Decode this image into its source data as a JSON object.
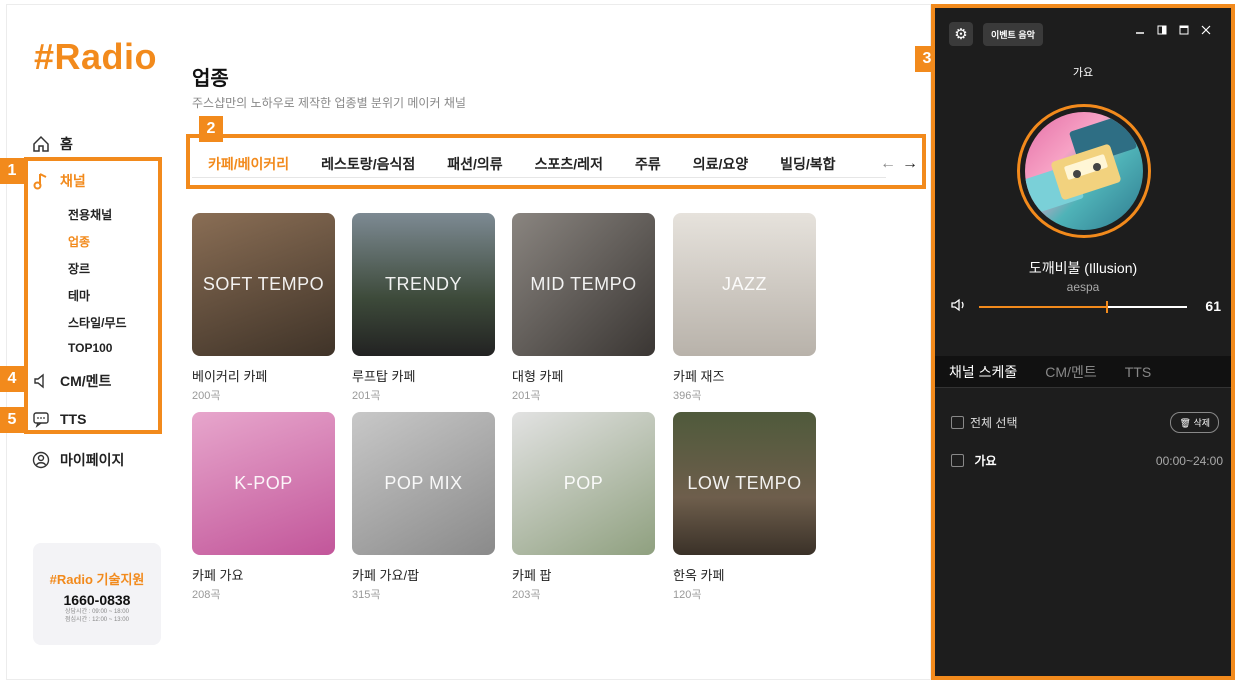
{
  "logo": "#Radio",
  "nav": {
    "home": "홈",
    "channel": "채널",
    "channel_sub": [
      "전용채널",
      "업종",
      "장르",
      "테마",
      "스타일/무드",
      "TOP100"
    ],
    "active_sub": "업종",
    "cm": "CM/멘트",
    "tts": "TTS",
    "mypage": "마이페이지"
  },
  "support": {
    "title": "#Radio 기술지원",
    "phone": "1660-0838",
    "hours1": "상담시간 : 09:00 ~ 18:00",
    "hours2": "점심시간 : 12:00 ~ 13:00"
  },
  "header": {
    "title": "업종",
    "subtitle": "주스샵만의 노하우로 제작한 업종별 분위기 메이커 채널"
  },
  "tabs": [
    "카페/베이커리",
    "레스토랑/음식점",
    "패션/의류",
    "스포츠/레저",
    "주류",
    "의료/요양",
    "빌딩/복합"
  ],
  "tab_prev": "←",
  "tab_next": "→",
  "cards": [
    {
      "label": "SOFT TEMPO",
      "name": "베이커리 카페",
      "count": "200곡",
      "color": "#6a5646"
    },
    {
      "label": "TRENDY",
      "name": "루프탑 카페",
      "count": "201곡",
      "color": "#56606a"
    },
    {
      "label": "MID TEMPO",
      "name": "대형 카페",
      "count": "201곡",
      "color": "#4a4542"
    },
    {
      "label": "JAZZ",
      "name": "카페 재즈",
      "count": "396곡",
      "color": "#c9c4bd"
    },
    {
      "label": "K-POP",
      "name": "카페 가요",
      "count": "208곡",
      "color": "#d989ba"
    },
    {
      "label": "POP MIX",
      "name": "카페 가요/팝",
      "count": "315곡",
      "color": "#a9a9a9"
    },
    {
      "label": "POP",
      "name": "카페 팝",
      "count": "203곡",
      "color": "#cfcfcf"
    },
    {
      "label": "LOW TEMPO",
      "name": "한옥 카페",
      "count": "120곡",
      "color": "#5a5244"
    }
  ],
  "badges": [
    "1",
    "2",
    "3",
    "4",
    "5"
  ],
  "player": {
    "gear_icon": "⚙",
    "event_btn": "이벤트 음악",
    "genre": "가요",
    "song": "도깨비불 (Illusion)",
    "artist": "aespa",
    "volume": 61,
    "volume_label": "61",
    "tabs": [
      "채널 스케줄",
      "CM/멘트",
      "TTS"
    ],
    "select_all": "전체 선택",
    "delete_btn": "삭제",
    "schedule": [
      {
        "name": "가요",
        "time": "00:00~24:00"
      }
    ]
  },
  "colors": {
    "accent": "#f28a1c",
    "panel": "#1d1d1d"
  }
}
